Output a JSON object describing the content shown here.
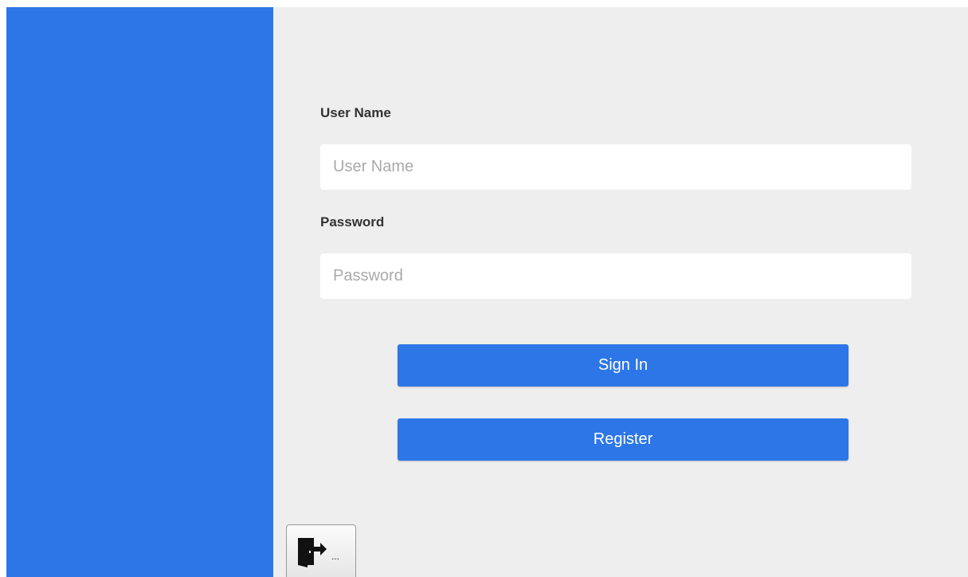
{
  "colors": {
    "accent": "#2d76e8",
    "panel_background": "#eeeeee"
  },
  "login_form": {
    "username_label": "User Name",
    "username_placeholder": "User Name",
    "username_value": "",
    "password_label": "Password",
    "password_placeholder": "Password",
    "password_value": ""
  },
  "actions": {
    "sign_in_label": "Sign In",
    "register_label": "Register"
  },
  "exit_button": {
    "icon": "exit-door-icon",
    "suffix": "..."
  }
}
